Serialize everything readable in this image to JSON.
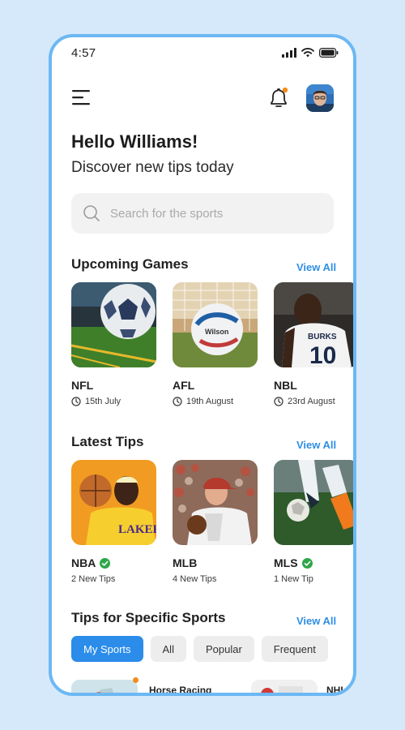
{
  "status_bar": {
    "time": "4:57"
  },
  "header": {
    "greeting": "Hello Williams!",
    "subtitle": "Discover new tips today",
    "menu_icon": "hamburger-icon",
    "bell_icon": "bell-icon",
    "notification_dot_color": "#f28c1e"
  },
  "search": {
    "placeholder": "Search for the sports",
    "value": ""
  },
  "upcoming": {
    "title": "Upcoming Games",
    "view_all": "View All",
    "items": [
      {
        "name": "NFL",
        "date": "15th July"
      },
      {
        "name": "AFL",
        "date": "19th August"
      },
      {
        "name": "NBL",
        "date": "23rd August"
      }
    ]
  },
  "latest_tips": {
    "title": "Latest Tips",
    "view_all": "View All",
    "items": [
      {
        "name": "NBA",
        "verified": true,
        "count": "2 New Tips"
      },
      {
        "name": "MLB",
        "verified": false,
        "count": "4 New Tips"
      },
      {
        "name": "MLS",
        "verified": true,
        "count": "1 New Tip"
      }
    ]
  },
  "specific": {
    "title": "Tips for Specific Sports",
    "view_all": "View All",
    "chips": [
      "My Sports",
      "All",
      "Popular",
      "Frequent"
    ],
    "active_chip": "My Sports",
    "items": [
      {
        "name": "Horse Racing"
      },
      {
        "name": "NHL"
      }
    ]
  },
  "colors": {
    "accent": "#2b8cea",
    "frame": "#6cb8f3",
    "verified": "#2fa64a",
    "background": "#d6e9fb"
  }
}
